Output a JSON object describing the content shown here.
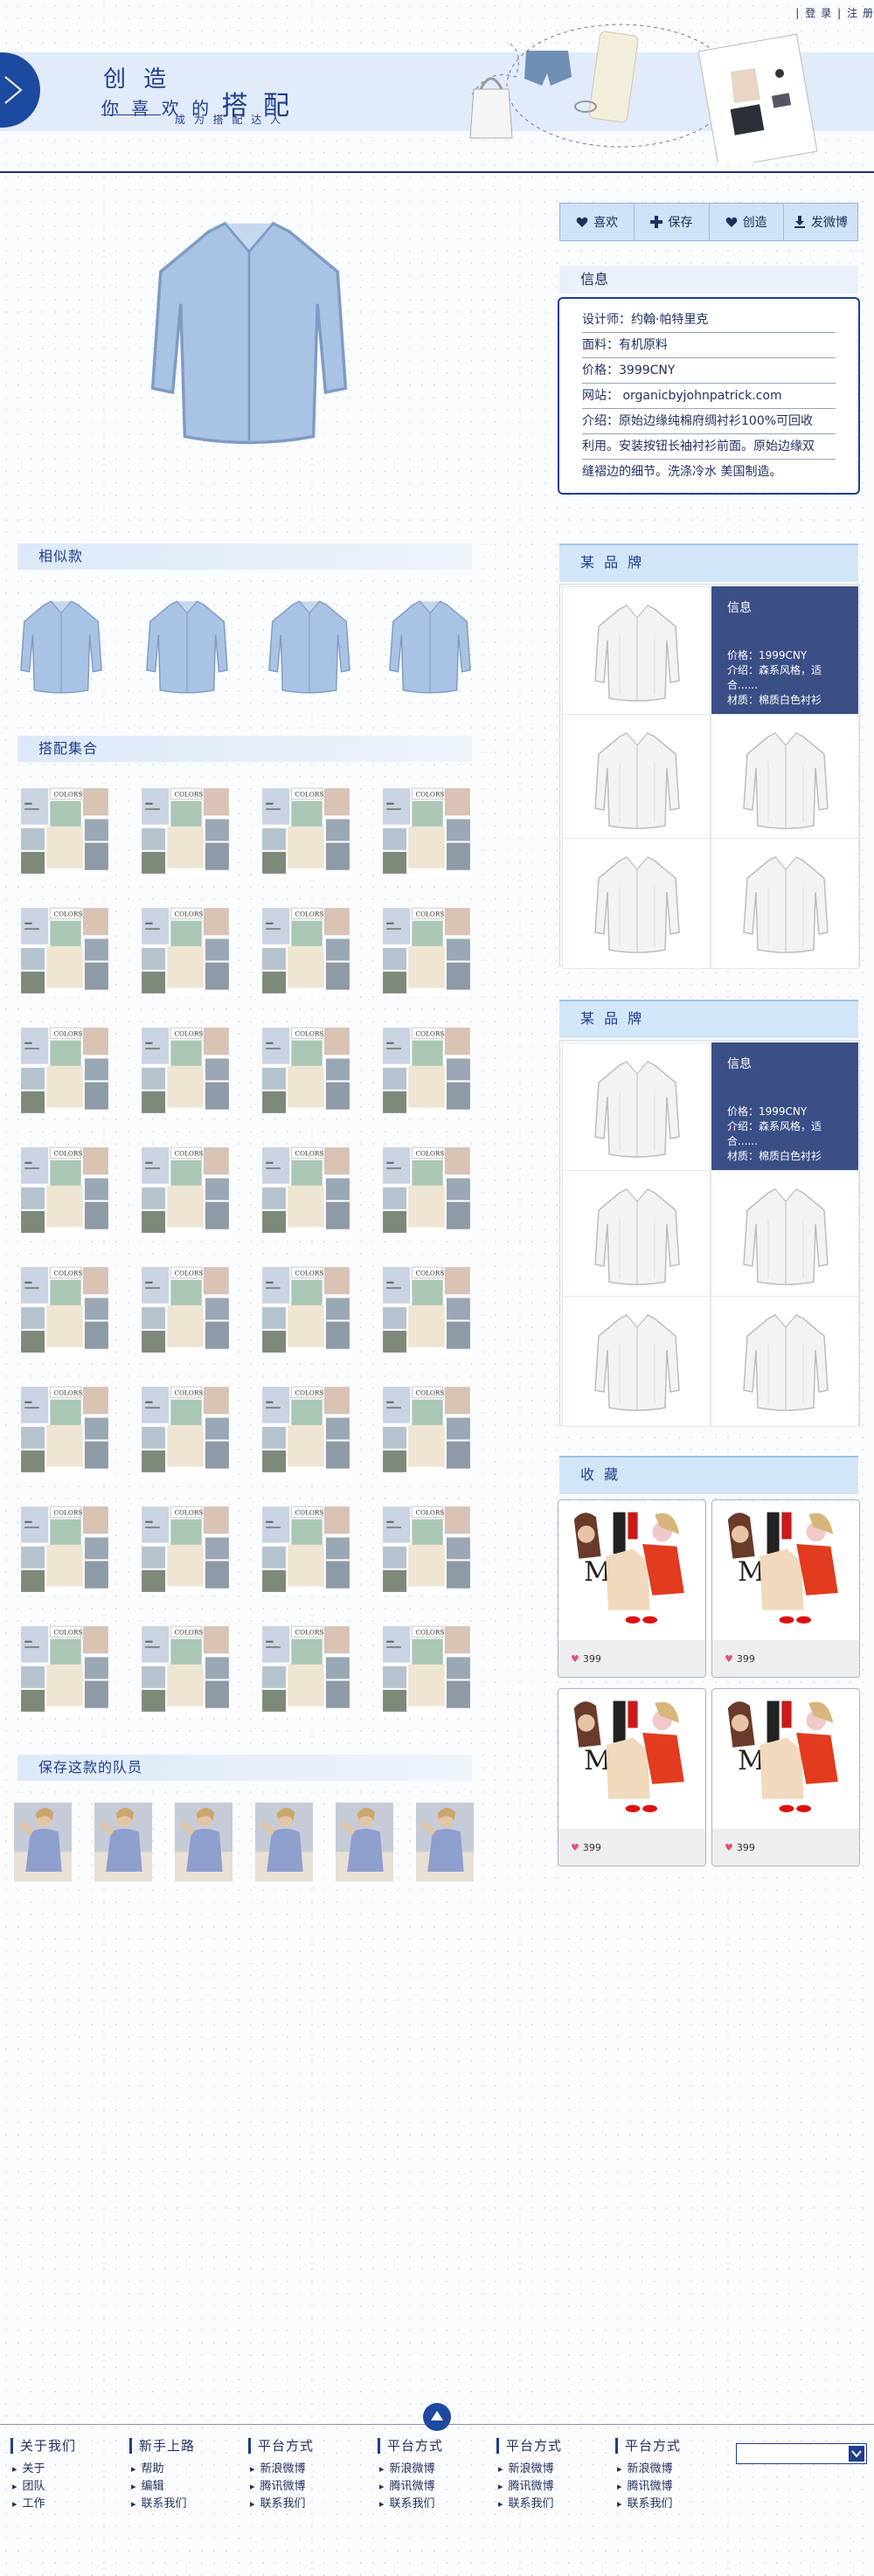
{
  "top_links": {
    "login": "登 录",
    "register": "注 册"
  },
  "banner": {
    "line1": "创 造",
    "line2_prefix": "你 喜 欢 的",
    "line2_big": "搭 配",
    "line3": "成 为 搭 配 达 人"
  },
  "actions": [
    {
      "label": "喜欢",
      "icon": "heart-icon"
    },
    {
      "label": "保存",
      "icon": "plus-icon"
    },
    {
      "label": "创造",
      "icon": "heart-icon"
    },
    {
      "label": "发微博",
      "icon": "download-icon"
    }
  ],
  "info": {
    "title": "信息",
    "designer": "设计师：约翰·帕特里克",
    "fabric": "面料：有机原料",
    "price": "价格：3999CNY",
    "website": "网站： organicbyjohnpatrick.com",
    "intro_line1": "介绍：原始边缘纯棉府绸衬衫100%可回收",
    "intro_line2": "利用。安装按钮长袖衬衫前面。原始边缘双",
    "intro_line3": "缝褶边的细节。洗涤冷水 美国制造。"
  },
  "sections": {
    "similar": "相似款",
    "collections": "搭配集合",
    "team": "保存这款的队员"
  },
  "brands": [
    {
      "title": "某 品 牌",
      "info_title": "信息",
      "price": "价格：1999CNY",
      "intro": "介绍：森系风格，适合......",
      "material": "材质：棉质白色衬衫"
    },
    {
      "title": "某 品 牌",
      "info_title": "信息",
      "price": "价格：1999CNY",
      "intro": "介绍：森系风格，适合......",
      "material": "材质：棉质白色衬衫"
    }
  ],
  "favorites": {
    "title": "收 藏",
    "items": [
      {
        "count": "399"
      },
      {
        "count": "399"
      },
      {
        "count": "399"
      },
      {
        "count": "399"
      }
    ]
  },
  "footer": {
    "columns": [
      {
        "title": "关于我们",
        "items": [
          "关于",
          "团队",
          "工作"
        ]
      },
      {
        "title": "新手上路",
        "items": [
          "帮助",
          "编辑",
          "联系我们"
        ]
      },
      {
        "title": "平台方式",
        "items": [
          "新浪微博",
          "腾讯微博",
          "联系我们"
        ]
      },
      {
        "title": "平台方式",
        "items": [
          "新浪微博",
          "腾讯微博",
          "联系我们"
        ]
      },
      {
        "title": "平台方式",
        "items": [
          "新浪微博",
          "腾讯微博",
          "联系我们"
        ]
      },
      {
        "title": "平台方式",
        "items": [
          "新浪微博",
          "腾讯微博",
          "联系我们"
        ]
      }
    ]
  },
  "colors": {
    "accent": "#1f3e8d",
    "banner_bg": "#e1ebf9",
    "info_panel": "#3a4f86"
  }
}
